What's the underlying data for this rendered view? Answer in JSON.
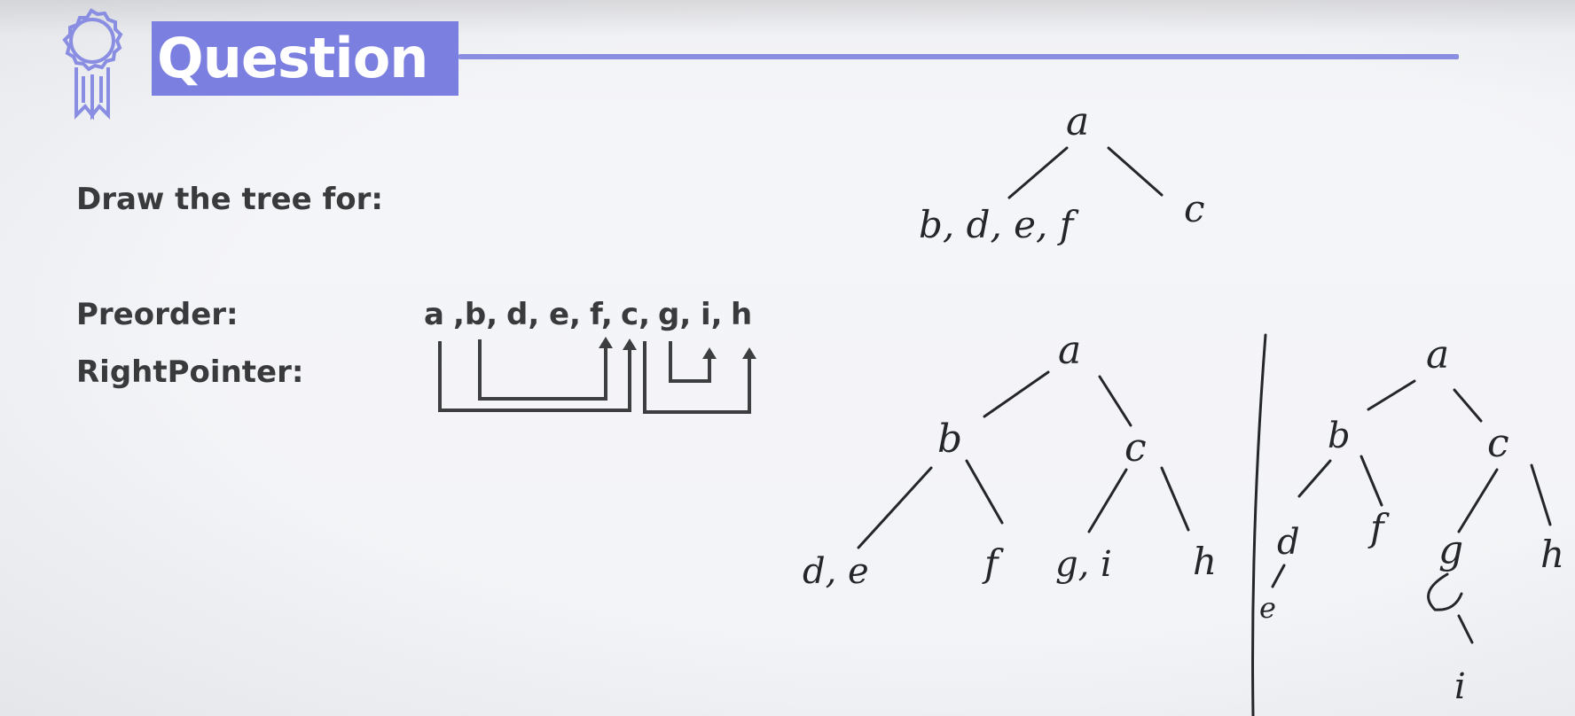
{
  "header": {
    "title": "Question",
    "icon": "award-ribbon-icon",
    "accent_color": "#7b7fe0"
  },
  "question": {
    "prompt": "Draw the tree for:",
    "preorder_label": "Preorder:",
    "rightpointer_label": "RightPointer:",
    "preorder_sequence": [
      "a",
      ",b,",
      "d,",
      "e,",
      "f,",
      "c,",
      "g,",
      "i,",
      "h"
    ]
  },
  "handwriting": {
    "tree1": {
      "root": "a",
      "left": "b, d, e, f",
      "right": "c"
    },
    "tree2": {
      "root": "a",
      "b": "b",
      "c": "c",
      "bl": "d, e",
      "br": "f",
      "cl": "g, i",
      "cr": "h"
    },
    "tree3": {
      "root": "a",
      "b": "b",
      "c": "c",
      "d": "d",
      "e": "e",
      "f": "f",
      "g": "g",
      "i": "i",
      "h": "h"
    }
  }
}
